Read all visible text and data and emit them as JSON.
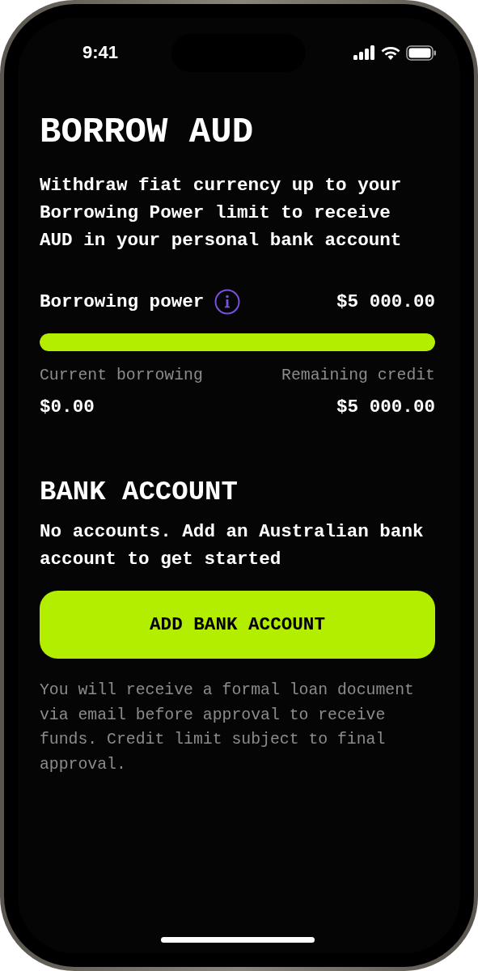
{
  "status_bar": {
    "time": "9:41"
  },
  "title": "BORROW AUD",
  "description": "Withdraw fiat currency up to your Borrowing Power limit to receive AUD in your personal bank account",
  "borrowing_power": {
    "label": "Borrowing power",
    "amount": "$5 000.00",
    "level": 1
  },
  "current_borrowing": {
    "label": "Current borrowing",
    "amount": "$0.00"
  },
  "remaining_credit": {
    "label": "Remaining credit",
    "amount": "$5 000.00"
  },
  "bank_account": {
    "heading": "BANK ACCOUNT",
    "message": "No accounts. Add an Australian bank account to get started",
    "button": "ADD BANK ACCOUNT"
  },
  "disclaimer": "You will receive a formal loan document via email before approval to receive funds. Credit limit subject to final approval."
}
